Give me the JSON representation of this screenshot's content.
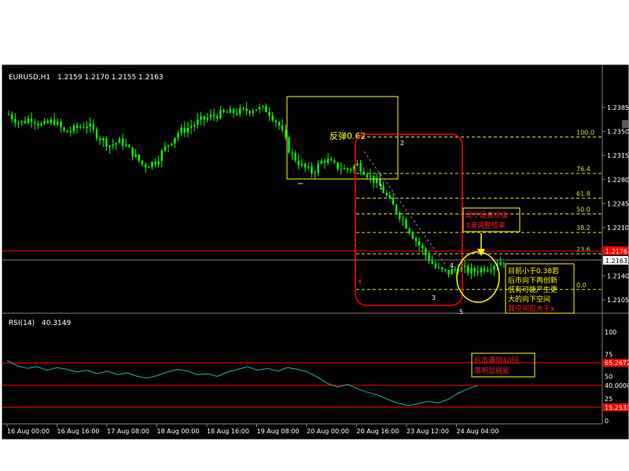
{
  "colors": {
    "background": "#000000",
    "candle": "#00ff00",
    "fib_lines": "#c8e832",
    "red_level": "#ff0000",
    "yellow_box": "#ffff00",
    "rsi_line": "#20b2aa",
    "axis_text": "#ffffff",
    "price_tag_bg": "#ffffff",
    "price_tag_red": "#ff0000"
  },
  "main_header": {
    "symbol_tf": "EURUSD,H1",
    "ohlc": "1.2159 1.2170 1.2155 1.2163"
  },
  "rsi_header": {
    "name": "RSI(14)",
    "value": "40.3149"
  },
  "price_axis": {
    "ticks": [
      1.2385,
      1.235,
      1.2315,
      1.228,
      1.2245,
      1.221,
      1.2175,
      1.214,
      1.2105
    ],
    "red_level_label": "1.2176",
    "current_price_label": "1.2163"
  },
  "rsi_axis": {
    "ticks": [
      "100",
      "75",
      "50",
      "40.0000",
      "25",
      "0"
    ],
    "ob_label": "65.2672",
    "os_label": "15.2533"
  },
  "time_axis": [
    "16 Aug 00:00",
    "16 Aug 16:00",
    "17 Aug 08:00",
    "18 Aug 00:00",
    "18 Aug 16:00",
    "19 Aug 08:00",
    "20 Aug 00:00",
    "20 Aug 16:00",
    "23 Aug 12:00",
    "24 Aug 04:00"
  ],
  "fib_levels": [
    "100.0",
    "76.4",
    "61.8",
    "50.0",
    "38.2",
    "23.6",
    "0.0"
  ],
  "annotations": {
    "rebound_label": "反弹0.62",
    "wave_1": "1",
    "wave_2": "2",
    "wave_3": "3",
    "wave_4": "4",
    "wave_5": "5",
    "wave_x": "x",
    "minus": "−",
    "question_box": [
      "是不是直次级",
      "3浪调整结束"
    ],
    "analysis_box": [
      "目前小于0.38若",
      "后市向下再创新",
      "低有可能产生更",
      "大的向下空间",
      "其空间应大于x"
    ],
    "rsi_box": [
      "后市遇阻40回",
      "落明显弱是"
    ]
  },
  "chart_data": [
    {
      "type": "candlestick",
      "title": "EURUSD,H1",
      "ylim": [
        1.209,
        1.241
      ],
      "ohlc_last": {
        "open": 1.2159,
        "high": 1.217,
        "low": 1.2155,
        "close": 1.2163
      },
      "x": [
        "16 Aug 00:00",
        "16 Aug 16:00",
        "17 Aug 08:00",
        "18 Aug 00:00",
        "18 Aug 16:00",
        "19 Aug 08:00",
        "20 Aug 00:00",
        "20 Aug 16:00",
        "23 Aug 12:00",
        "24 Aug 04:00"
      ],
      "price_path": [
        1.2375,
        1.2362,
        1.237,
        1.2358,
        1.2366,
        1.2348,
        1.2355,
        1.236,
        1.2342,
        1.233,
        1.2336,
        1.2318,
        1.23,
        1.2306,
        1.2328,
        1.2348,
        1.2356,
        1.2366,
        1.2372,
        1.2376,
        1.2378,
        1.238,
        1.2384,
        1.2381,
        1.236,
        1.232,
        1.23,
        1.229,
        1.231,
        1.23,
        1.2294,
        1.2302,
        1.2286,
        1.227,
        1.2245,
        1.2222,
        1.2196,
        1.2172,
        1.215,
        1.2144,
        1.2152,
        1.2146,
        1.215,
        1.2156,
        1.2163
      ],
      "horizontal_lines": {
        "red_level": 1.2176,
        "current": 1.2163
      },
      "fibonacci": {
        "100.0": 1.2342,
        "76.4": 1.2289,
        "61.8": 1.2253,
        "50.0": 1.223,
        "38.2": 1.2203,
        "23.6": 1.2172,
        "0.0": 1.212
      }
    },
    {
      "type": "line",
      "title": "RSI(14)",
      "ylim": [
        0,
        100
      ],
      "value_last": 40.3149,
      "levels": [
        65.2672,
        40.0,
        15.2533
      ],
      "values": [
        68,
        62,
        59,
        61,
        57,
        60,
        58,
        55,
        57,
        53,
        56,
        52,
        54,
        50,
        48,
        51,
        55,
        58,
        56,
        52,
        53,
        50,
        55,
        58,
        61,
        57,
        59,
        56,
        60,
        58,
        55,
        49,
        42,
        38,
        41,
        36,
        32,
        29,
        24,
        20,
        17,
        19,
        22,
        20,
        24,
        31,
        36,
        40
      ]
    }
  ]
}
